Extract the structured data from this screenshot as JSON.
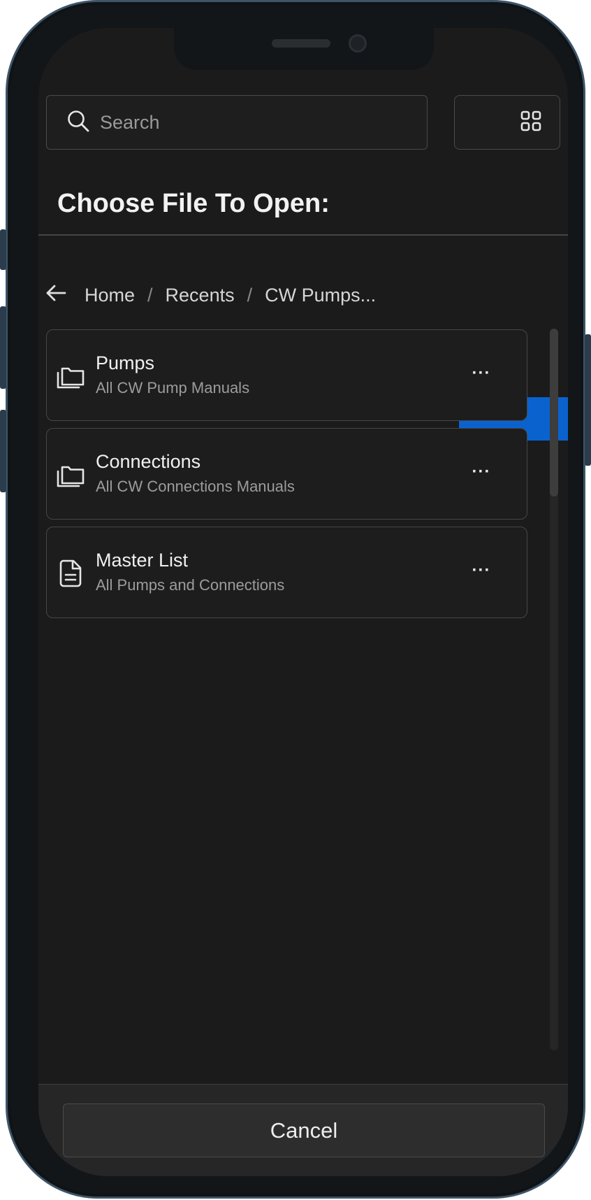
{
  "search": {
    "placeholder": "Search",
    "value": ""
  },
  "view_toggle": {
    "active": "list",
    "options": [
      "list",
      "grid"
    ],
    "active_color": "#0a62cf"
  },
  "dialog": {
    "title": "Choose File To Open:"
  },
  "breadcrumb": {
    "back_icon": "arrow-left-icon",
    "items": [
      "Home",
      "Recents",
      "CW Pumps..."
    ],
    "separator": "/"
  },
  "files": [
    {
      "type": "folder",
      "icon": "folder-stack-icon",
      "title": "Pumps",
      "subtitle": "All CW Pump Manuals",
      "more_label": "···"
    },
    {
      "type": "folder",
      "icon": "folder-stack-icon",
      "title": "Connections",
      "subtitle": "All CW Connections Manuals",
      "more_label": "···"
    },
    {
      "type": "document",
      "icon": "document-icon",
      "title": "Master List",
      "subtitle": "All Pumps and Connections",
      "more_label": "···"
    }
  ],
  "footer": {
    "cancel_label": "Cancel"
  }
}
